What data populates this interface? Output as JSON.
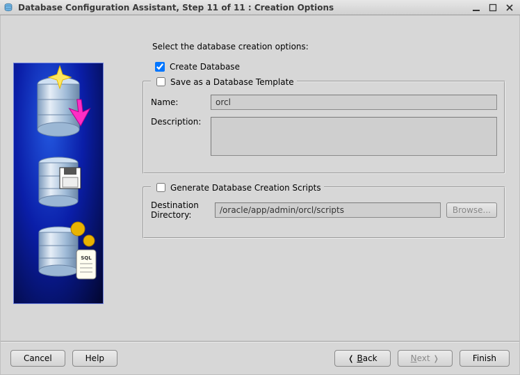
{
  "window": {
    "title": "Database Configuration Assistant, Step 11 of 11 : Creation Options"
  },
  "intro": "Select the database creation options:",
  "create_db": {
    "checked": true,
    "label": "Create Database"
  },
  "template": {
    "checked": false,
    "legend_label": "Save as a Database Template",
    "name_label": "Name:",
    "name_value": "orcl",
    "desc_label": "Description:",
    "desc_value": ""
  },
  "scripts": {
    "checked": false,
    "legend_label": "Generate Database Creation Scripts",
    "dest_label_line1": "Destination",
    "dest_label_line2": "Directory:",
    "dest_value": "/oracle/app/admin/orcl/scripts",
    "browse_label": "Browse..."
  },
  "buttons": {
    "cancel": "Cancel",
    "help": "Help",
    "back_prefix": "B",
    "back_rest": "ack",
    "next_prefix": "N",
    "next_rest": "ext",
    "finish": "Finish"
  }
}
